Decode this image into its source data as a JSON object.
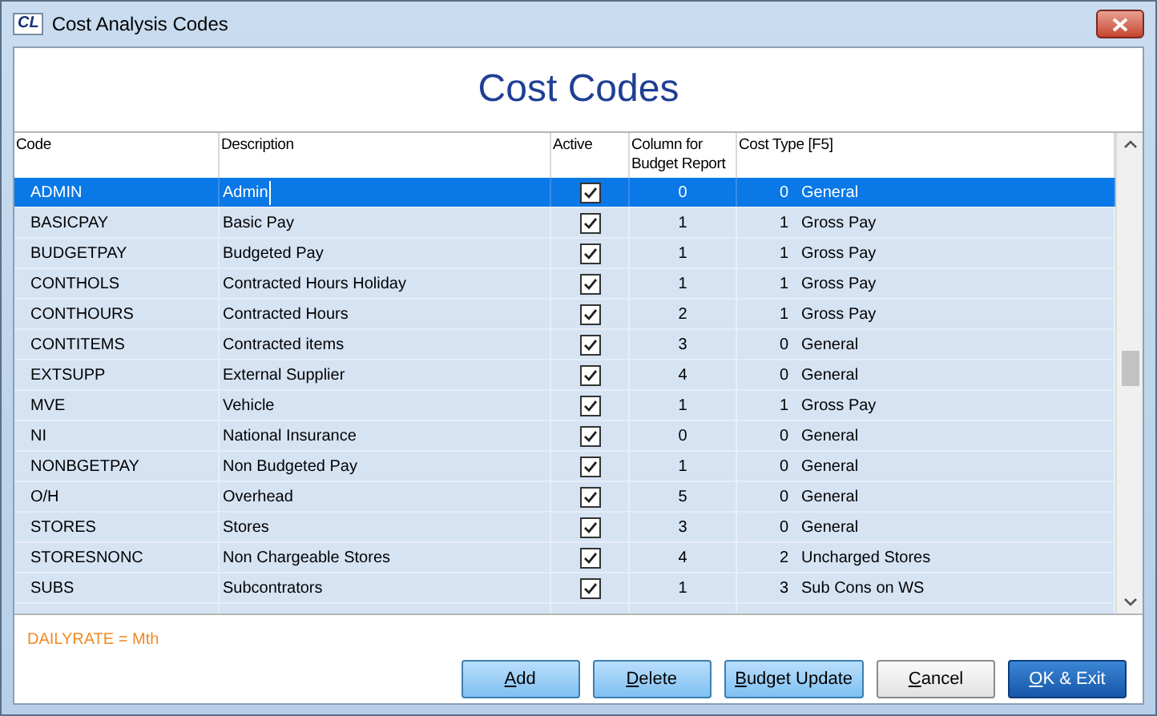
{
  "window": {
    "logo": "CL",
    "title": "Cost Analysis Codes"
  },
  "heading": "Cost Codes",
  "table": {
    "columns": [
      "Code",
      "Description",
      "Active",
      "Column for Budget Report",
      "Cost Type [F5]"
    ],
    "rows": [
      {
        "code": "ADMIN",
        "description": "Admin",
        "active": true,
        "budget_column": "0",
        "cost_type_code": "0",
        "cost_type": "General",
        "selected": true
      },
      {
        "code": "BASICPAY",
        "description": "Basic Pay",
        "active": true,
        "budget_column": "1",
        "cost_type_code": "1",
        "cost_type": "Gross Pay",
        "selected": false
      },
      {
        "code": "BUDGETPAY",
        "description": "Budgeted Pay",
        "active": true,
        "budget_column": "1",
        "cost_type_code": "1",
        "cost_type": "Gross Pay",
        "selected": false
      },
      {
        "code": "CONTHOLS",
        "description": "Contracted Hours Holiday",
        "active": true,
        "budget_column": "1",
        "cost_type_code": "1",
        "cost_type": "Gross Pay",
        "selected": false
      },
      {
        "code": "CONTHOURS",
        "description": "Contracted Hours",
        "active": true,
        "budget_column": "2",
        "cost_type_code": "1",
        "cost_type": "Gross Pay",
        "selected": false
      },
      {
        "code": "CONTITEMS",
        "description": "Contracted items",
        "active": true,
        "budget_column": "3",
        "cost_type_code": "0",
        "cost_type": "General",
        "selected": false
      },
      {
        "code": "EXTSUPP",
        "description": "External Supplier",
        "active": true,
        "budget_column": "4",
        "cost_type_code": "0",
        "cost_type": "General",
        "selected": false
      },
      {
        "code": "MVE",
        "description": "Vehicle",
        "active": true,
        "budget_column": "1",
        "cost_type_code": "1",
        "cost_type": "Gross Pay",
        "selected": false
      },
      {
        "code": "NI",
        "description": "National Insurance",
        "active": true,
        "budget_column": "0",
        "cost_type_code": "0",
        "cost_type": "General",
        "selected": false
      },
      {
        "code": "NONBGETPAY",
        "description": "Non Budgeted Pay",
        "active": true,
        "budget_column": "1",
        "cost_type_code": "0",
        "cost_type": "General",
        "selected": false
      },
      {
        "code": "O/H",
        "description": "Overhead",
        "active": true,
        "budget_column": "5",
        "cost_type_code": "0",
        "cost_type": "General",
        "selected": false
      },
      {
        "code": "STORES",
        "description": "Stores",
        "active": true,
        "budget_column": "3",
        "cost_type_code": "0",
        "cost_type": "General",
        "selected": false
      },
      {
        "code": "STORESNONC",
        "description": "Non Chargeable Stores",
        "active": true,
        "budget_column": "4",
        "cost_type_code": "2",
        "cost_type": "Uncharged Stores",
        "selected": false
      },
      {
        "code": "SUBS",
        "description": "Subcontrators",
        "active": true,
        "budget_column": "1",
        "cost_type_code": "3",
        "cost_type": "Sub Cons on WS",
        "selected": false
      }
    ]
  },
  "note": "DAILYRATE = Mth",
  "buttons": [
    {
      "label": "Add",
      "kind": "action"
    },
    {
      "label": "Delete",
      "kind": "action"
    },
    {
      "label": "Budget Update",
      "kind": "action"
    },
    {
      "label": "Cancel",
      "kind": "plain"
    },
    {
      "label": "OK & Exit",
      "kind": "primary"
    }
  ]
}
